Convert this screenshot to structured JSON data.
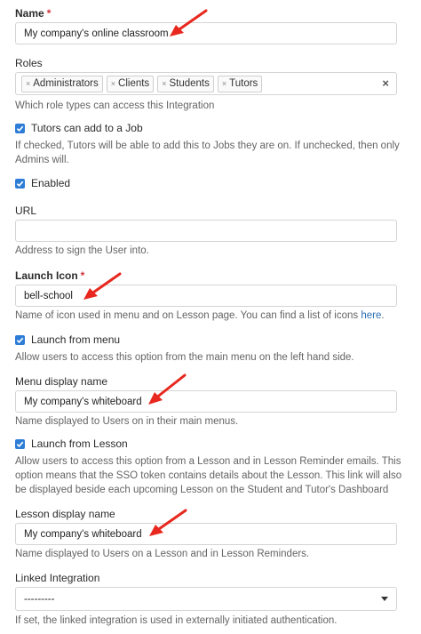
{
  "name": {
    "label": "Name",
    "required": "*",
    "value": "My company's online classroom"
  },
  "roles": {
    "label": "Roles",
    "tags": [
      "Administrators",
      "Clients",
      "Students",
      "Tutors"
    ],
    "remove_glyph": "×",
    "clear_glyph": "×",
    "help": "Which role types can access this Integration"
  },
  "tutors_add": {
    "label": "Tutors can add to a Job",
    "checked": true,
    "help": "If checked, Tutors will be able to add this to Jobs they are on. If unchecked, then only Admins will."
  },
  "enabled": {
    "label": "Enabled",
    "checked": true
  },
  "url": {
    "label": "URL",
    "value": "",
    "help": "Address to sign the User into."
  },
  "launch_icon": {
    "label": "Launch Icon",
    "required": "*",
    "value": "bell-school",
    "help": "Name of icon used in menu and on Lesson page. You can find a list of icons ",
    "help_link": "here",
    "help_end": "."
  },
  "launch_menu": {
    "label": "Launch from menu",
    "checked": true,
    "help": "Allow users to access this option from the main menu on the left hand side."
  },
  "menu_display": {
    "label": "Menu display name",
    "value": "My company's whiteboard",
    "help": "Name displayed to Users on in their main menus."
  },
  "launch_lesson": {
    "label": "Launch from Lesson",
    "checked": true,
    "help": "Allow users to access this option from a Lesson and in Lesson Reminder emails. This option means that the SSO token contains details about the Lesson. This link will also be displayed beside each upcoming Lesson on the Student and Tutor's Dashboard"
  },
  "lesson_display": {
    "label": "Lesson display name",
    "value": "My company's whiteboard",
    "help": "Name displayed to Users on a Lesson and in Lesson Reminders."
  },
  "linked": {
    "label": "Linked Integration",
    "selected": "---------",
    "help": "If set, the linked integration is used in externally initiated authentication."
  },
  "colors": {
    "accent": "#2d7cd6",
    "required": "#d0303a",
    "annotation_arrow": "#e8281e",
    "link": "#2a6fb5"
  },
  "icons": {
    "checkbox": "checkmark-icon",
    "annotation": "red-arrow-icon",
    "select": "chevron-down-icon"
  }
}
